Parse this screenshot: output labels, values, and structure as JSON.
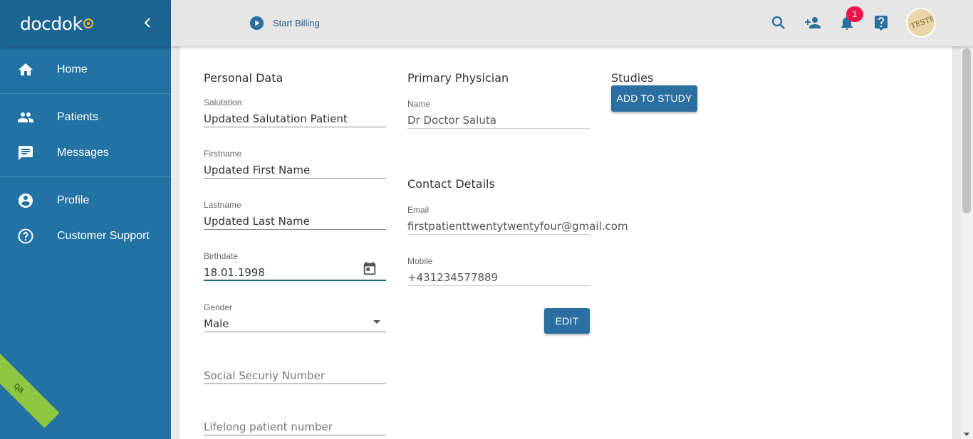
{
  "app": {
    "logo": "docdok",
    "env_ribbon": "qa"
  },
  "sidebar": {
    "items": [
      {
        "label": "Home",
        "icon": "home-icon"
      },
      {
        "label": "Patients",
        "icon": "people-icon"
      },
      {
        "label": "Messages",
        "icon": "message-icon"
      },
      {
        "label": "Profile",
        "icon": "account-circle-icon"
      },
      {
        "label": "Customer Support",
        "icon": "help-circle-icon"
      }
    ]
  },
  "topbar": {
    "billing_label": "Start Billing",
    "notification_count": "1",
    "avatar_text": "TESTEN"
  },
  "personal": {
    "title": "Personal Data",
    "salutation": {
      "label": "Salutation",
      "value": "Updated Salutation Patient"
    },
    "firstname": {
      "label": "Firstname",
      "value": "Updated First Name"
    },
    "lastname": {
      "label": "Lastname",
      "value": "Updated Last Name"
    },
    "birthdate": {
      "label": "Birthdate",
      "value": "18.01.1998"
    },
    "gender": {
      "label": "Gender",
      "value": "Male"
    },
    "ssn": {
      "placeholder": "Social Securiy Number"
    },
    "lifelong": {
      "placeholder": "Lifelong patient number"
    }
  },
  "physician": {
    "title": "Primary Physician",
    "name": {
      "label": "Name",
      "value": "Dr Doctor Saluta"
    }
  },
  "contact": {
    "title": "Contact Details",
    "email": {
      "label": "Email",
      "value": "firstpatienttwentytwentyfour@gmail.com"
    },
    "mobile": {
      "label": "Mobile",
      "value": "+431234577889"
    },
    "edit_label": "EDIT"
  },
  "studies": {
    "title": "Studies",
    "add_label": "ADD TO STUDY"
  },
  "colors": {
    "sidebar": "#2272a3",
    "sidebar_header": "#1c6592",
    "primary_button": "#2a6fa0",
    "badge": "#e8174a",
    "ribbon": "#8dc63f"
  }
}
